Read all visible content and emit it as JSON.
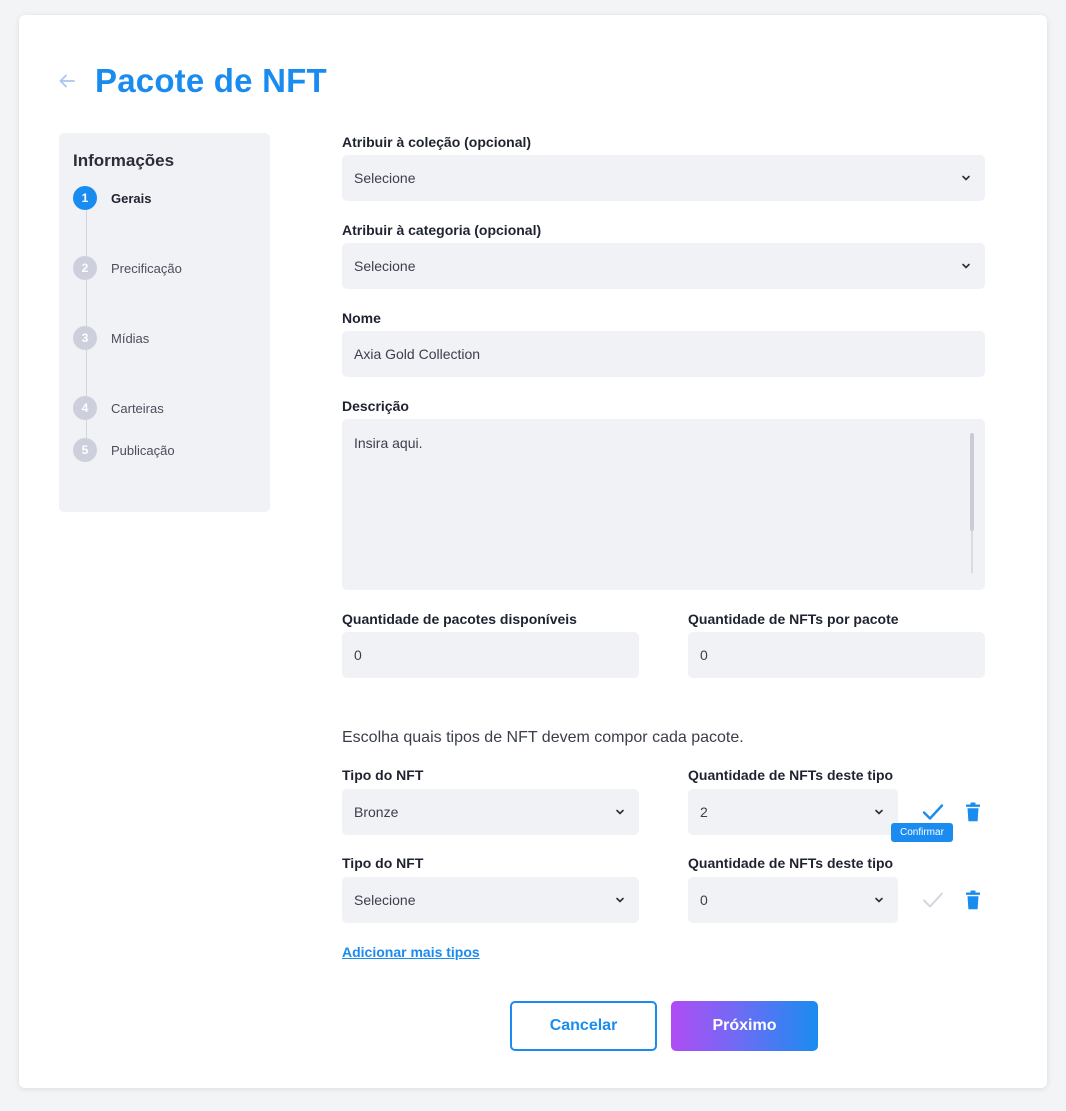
{
  "page": {
    "title": "Pacote de NFT"
  },
  "sidebar": {
    "title": "Informações",
    "steps": [
      {
        "number": "1",
        "label": "Gerais"
      },
      {
        "number": "2",
        "label": "Precificação"
      },
      {
        "number": "3",
        "label": "Mídias"
      },
      {
        "number": "4",
        "label": "Carteiras"
      },
      {
        "number": "5",
        "label": "Publicação"
      }
    ]
  },
  "form": {
    "collection": {
      "label": "Atribuir à coleção (opcional)",
      "value": "Selecione"
    },
    "category": {
      "label": "Atribuir à categoria (opcional)",
      "value": "Selecione"
    },
    "name": {
      "label": "Nome",
      "value": "Axia Gold Collection"
    },
    "description": {
      "label": "Descrição",
      "placeholder": "Insira aqui."
    },
    "packages_qty": {
      "label": "Quantidade de pacotes disponíveis",
      "value": "0"
    },
    "nfts_per_package": {
      "label": "Quantidade de NFTs por pacote",
      "value": "0"
    },
    "types_intro": "Escolha quais tipos de NFT devem compor cada pacote.",
    "types": [
      {
        "type_label": "Tipo do NFT",
        "type_value": "Bronze",
        "qty_label": "Quantidade de NFTs deste tipo",
        "qty_value": "2",
        "confirmed_active": true
      },
      {
        "type_label": "Tipo do NFT",
        "type_value": "Selecione",
        "qty_label": "Quantidade de NFTs deste tipo",
        "qty_value": "0",
        "confirmed_active": false
      }
    ],
    "confirm_tooltip": "Confirmar",
    "add_more": "Adicionar mais tipos"
  },
  "actions": {
    "cancel": "Cancelar",
    "next": "Próximo"
  },
  "colors": {
    "accent": "#1a8cf0",
    "gradient_start": "#b04cf3",
    "input_bg": "#f1f2f6"
  },
  "icons": {
    "back": "arrow-left-icon",
    "dropdown": "chevron-down-icon",
    "confirm": "check-icon",
    "delete": "trash-icon"
  }
}
